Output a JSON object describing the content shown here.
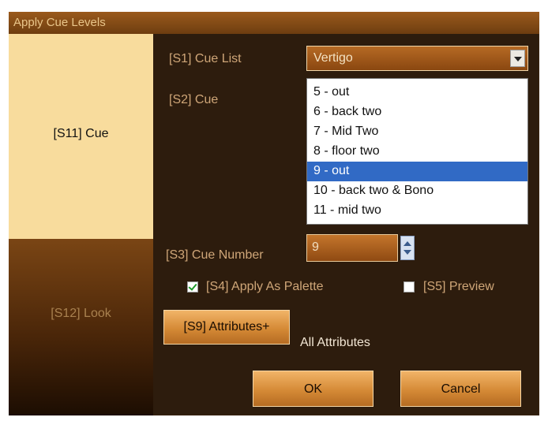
{
  "window": {
    "title": "Apply Cue Levels"
  },
  "sidebar": {
    "items": [
      {
        "label": "[S11] Cue",
        "selected": true
      },
      {
        "label": "[S12] Look",
        "selected": false
      }
    ]
  },
  "form": {
    "cue_list": {
      "label": "[S1] Cue List",
      "value": "Vertigo"
    },
    "cue": {
      "label": "[S2] Cue",
      "items": [
        "5 - out",
        "6 - back two",
        "7 - Mid Two",
        "8 - floor two",
        "9 - out",
        "10 - back two & Bono",
        "11 - mid two"
      ],
      "selected_index": 4
    },
    "cue_number": {
      "label": "[S3] Cue Number",
      "value": "9"
    },
    "apply_as_palette": {
      "label": "[S4] Apply As Palette",
      "checked": true
    },
    "preview": {
      "label": "[S5] Preview",
      "checked": false
    },
    "attributes": {
      "button_label": "[S9] Attributes+",
      "summary": "All Attributes"
    }
  },
  "buttons": {
    "ok": "OK",
    "cancel": "Cancel"
  },
  "colors": {
    "panel_bg": "#2d1c0d",
    "selected_tab": "#f8dc9d",
    "label_text": "#cfa678",
    "list_selection": "#316ac5",
    "button_gradient": "#d58a36"
  },
  "icons": {
    "dropdown": "chevron-down-icon",
    "spinner": "spinner-arrows-icon",
    "checkmark": "check-icon"
  }
}
